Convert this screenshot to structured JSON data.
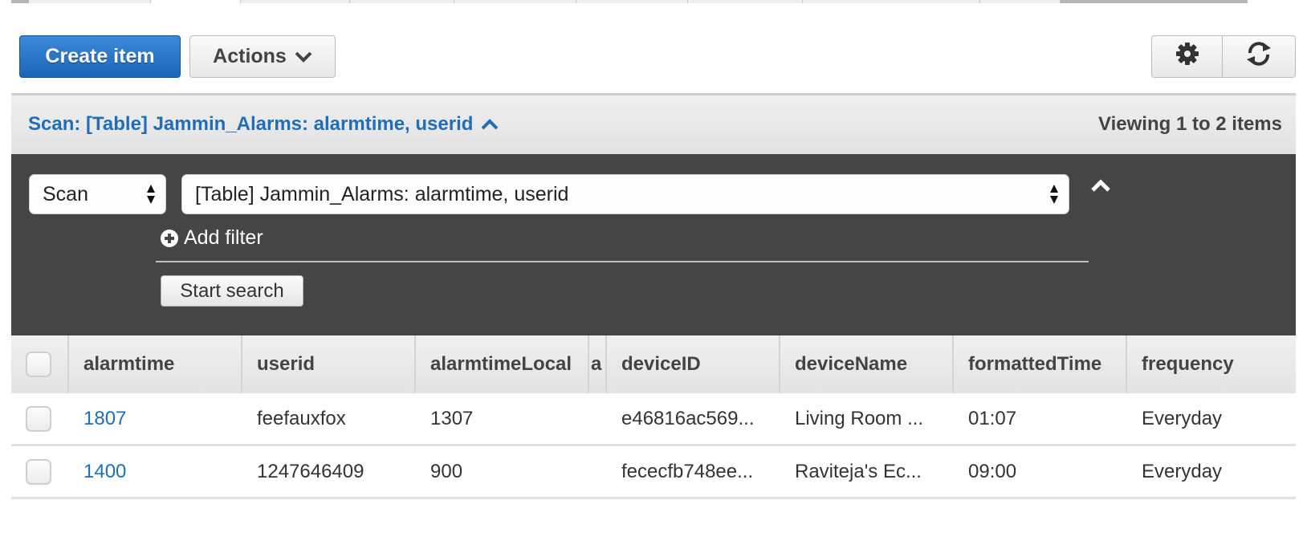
{
  "toolbar": {
    "create_label": "Create item",
    "actions_label": "Actions",
    "settings_icon": "gear-icon",
    "refresh_icon": "refresh-icon"
  },
  "scan_header": {
    "title": "Scan: [Table] Jammin_Alarms: alarmtime, userid",
    "viewing": "Viewing 1 to 2 items"
  },
  "query": {
    "operation": "Scan",
    "table": "[Table] Jammin_Alarms: alarmtime, userid",
    "add_filter": "Add filter",
    "start_search": "Start search"
  },
  "table": {
    "columns": [
      "alarmtime",
      "userid",
      "alarmtimeLocal",
      "a",
      "deviceID",
      "deviceName",
      "formattedTime",
      "frequency"
    ],
    "rows": [
      {
        "alarmtime": "1807",
        "userid": "feefauxfox",
        "alarmtimeLocal": "1307",
        "deviceID": "e46816ac569...",
        "deviceName": "Living Room ...",
        "formattedTime": "01:07",
        "frequency": "Everyday"
      },
      {
        "alarmtime": "1400",
        "userid": "1247646409",
        "alarmtimeLocal": "900",
        "deviceID": "fececfb748ee...",
        "deviceName": "Raviteja's Ec...",
        "formattedTime": "09:00",
        "frequency": "Everyday"
      }
    ]
  },
  "colors": {
    "primary": "#1f6eb7",
    "panel_dark": "#454545",
    "header_bg": "#e8e8e8"
  }
}
